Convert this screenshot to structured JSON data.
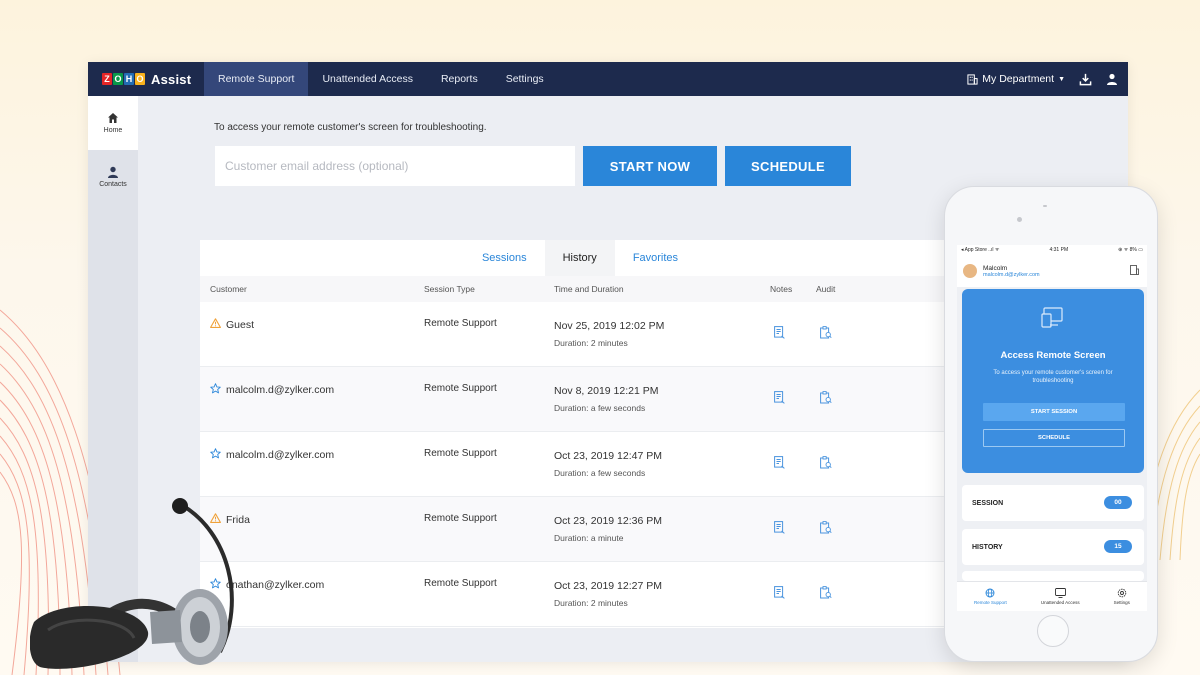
{
  "colors": {
    "topbar": "#1d2a4d",
    "nav_active": "#34477a",
    "primary": "#2a86d9",
    "phone_card": "#3c8ee0",
    "warning": "#f0a23a"
  },
  "header": {
    "logo_letters": [
      "Z",
      "O",
      "H",
      "O"
    ],
    "logo_text": "Assist",
    "nav": [
      "Remote Support",
      "Unattended Access",
      "Reports",
      "Settings"
    ],
    "department": "My Department",
    "icons": [
      "building-icon",
      "download-icon",
      "user-icon"
    ]
  },
  "sidebar": {
    "items": [
      {
        "label": "Home",
        "icon": "home-icon"
      },
      {
        "label": "Contacts",
        "icon": "person-icon"
      }
    ]
  },
  "launcher": {
    "intro": "To access your remote customer's screen for troubleshooting.",
    "email_placeholder": "Customer email address (optional)",
    "start_label": "START NOW",
    "schedule_label": "SCHEDULE"
  },
  "tabs": [
    "Sessions",
    "History",
    "Favorites"
  ],
  "table": {
    "headers": {
      "customer": "Customer",
      "type": "Session Type",
      "time": "Time and Duration",
      "notes": "Notes",
      "audit": "Audit"
    },
    "rows": [
      {
        "icon": "warning-icon",
        "customer": "Guest",
        "type": "Remote Support",
        "time": "Nov 25, 2019 12:02 PM",
        "duration": "Duration: 2 minutes"
      },
      {
        "icon": "star-icon",
        "customer": "malcolm.d@zylker.com",
        "type": "Remote Support",
        "time": "Nov 8, 2019 12:21 PM",
        "duration": "Duration: a few seconds"
      },
      {
        "icon": "star-icon",
        "customer": "malcolm.d@zylker.com",
        "type": "Remote Support",
        "time": "Oct 23, 2019 12:47 PM",
        "duration": "Duration: a few seconds"
      },
      {
        "icon": "warning-icon",
        "customer": "Frida",
        "type": "Remote Support",
        "time": "Oct 23, 2019 12:36 PM",
        "duration": "Duration: a minute"
      },
      {
        "icon": "star-icon",
        "customer": "onathan@zylker.com",
        "type": "Remote Support",
        "time": "Oct 23, 2019 12:27 PM",
        "duration": "Duration: 2 minutes"
      }
    ]
  },
  "phone": {
    "status_left": "◂ App Store ..ıl ᯤ",
    "status_time": "4:31 PM",
    "status_right": "⊕ ᯤ 8% ▭",
    "user_name": "Malcolm",
    "user_email": "malcolm.d@zylker.com",
    "card_title": "Access Remote Screen",
    "card_desc": "To access your remote customer's screen for troubleshooting",
    "start_session": "START SESSION",
    "schedule": "SCHEDULE",
    "session_label": "SESSION",
    "session_count": "00",
    "history_label": "HISTORY",
    "history_count": "15",
    "bottom_tabs": [
      "Remote Support",
      "Unattended Access",
      "Settings"
    ]
  }
}
